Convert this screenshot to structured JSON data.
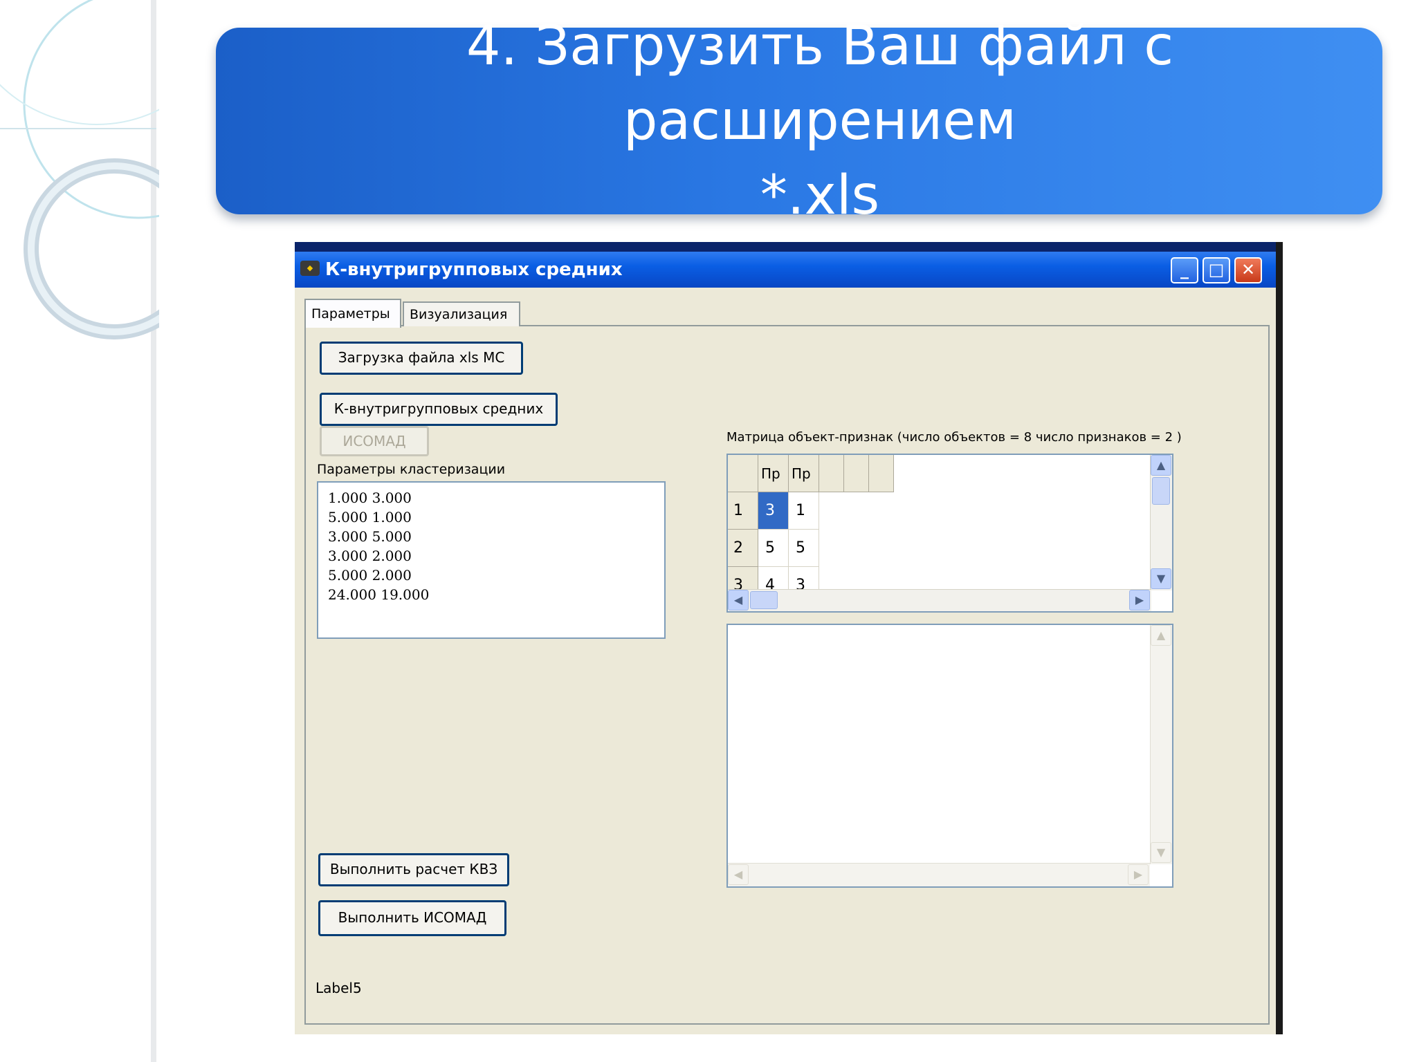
{
  "slide": {
    "title": "4. Загрузить Ваш файл с расширением\n*.xls"
  },
  "window": {
    "title": "К-внутригрупповых средних",
    "icon_name": "app-icon",
    "controls": [
      "minimize-icon",
      "maximize-icon",
      "close-icon"
    ]
  },
  "tabs": [
    {
      "label": "Параметры"
    },
    {
      "label": "Визуализация"
    }
  ],
  "buttons": {
    "load_file": "Загрузка файла xls МС",
    "k_means": "К-внутригрупповых средних",
    "isodata": "ИСОМАД",
    "run_k": "Выполнить расчет КВЗ",
    "run_isodata": "Выполнить ИСОМАД"
  },
  "labels": {
    "cluster_params": "Параметры кластеризации",
    "matrix_caption": "Матрица объект-признак (число объектов = 8 число признаков = 2 )",
    "bottom_label": "Label5"
  },
  "cluster_params_list": [
    "1.000 3.000",
    "5.000 1.000",
    "3.000 5.000",
    "3.000 2.000",
    "5.000 2.000",
    "24.000 19.000"
  ],
  "grid": {
    "headers": [
      "Пр",
      "Пр"
    ],
    "rows": [
      {
        "num": "1",
        "cells": [
          "3",
          "1"
        ]
      },
      {
        "num": "2",
        "cells": [
          "5",
          "5"
        ]
      },
      {
        "num": "3",
        "cells": [
          "4",
          "3"
        ]
      }
    ]
  }
}
